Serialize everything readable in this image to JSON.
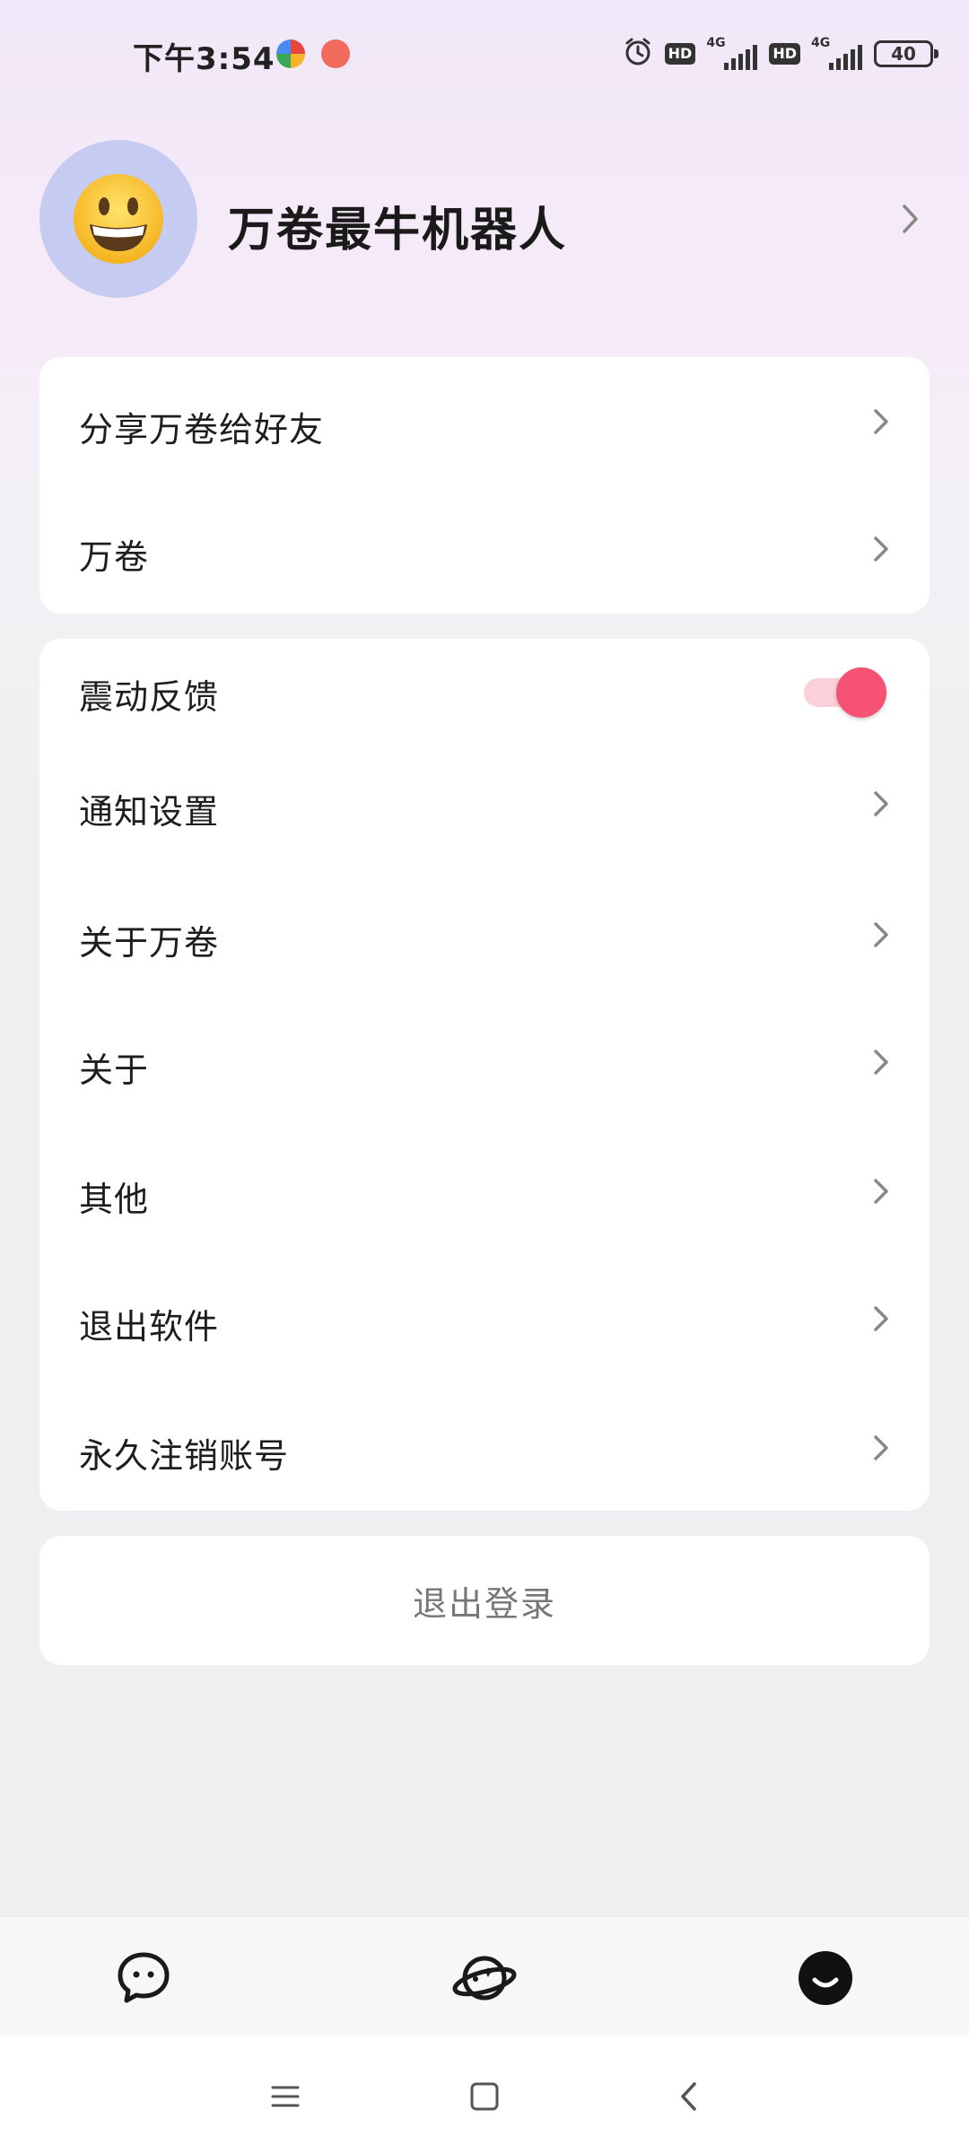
{
  "status_bar": {
    "time": "下午3:54",
    "hd1": "HD",
    "hd2": "HD",
    "net1": "4G",
    "net2": "4G",
    "battery": "40",
    "icons": [
      "alarm-icon",
      "signal-icon",
      "battery-icon"
    ]
  },
  "profile": {
    "username": "万卷最牛机器人",
    "avatar_emoji": "😀"
  },
  "menu_group_1": [
    {
      "label": "分享万卷给好友"
    },
    {
      "label": "万卷"
    }
  ],
  "menu_group_2": {
    "vibration": {
      "label": "震动反馈",
      "enabled": true
    },
    "items": [
      {
        "label": "通知设置"
      },
      {
        "label": "关于万卷"
      },
      {
        "label": "关于"
      },
      {
        "label": "其他"
      },
      {
        "label": "退出软件"
      },
      {
        "label": "永久注销账号"
      }
    ]
  },
  "logout_label": "退出登录",
  "tabbar": {
    "tabs": [
      {
        "icon": "chat-icon"
      },
      {
        "icon": "planet-icon"
      },
      {
        "icon": "profile-smile-icon",
        "active": true
      }
    ]
  },
  "colors": {
    "accent": "#f55274",
    "toggle_track": "#fbd0d9",
    "avatar_bg": "#c6cbf2"
  }
}
